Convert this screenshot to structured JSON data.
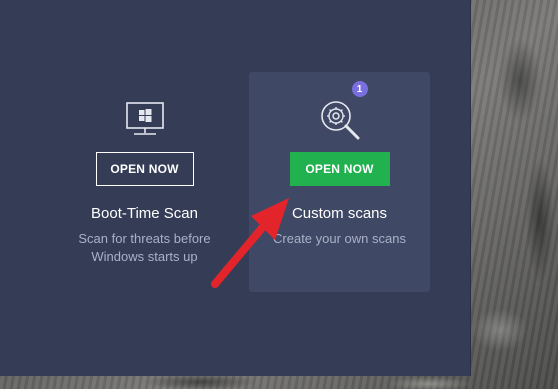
{
  "cards": [
    {
      "title": "Boot-Time Scan",
      "button": "OPEN NOW",
      "description_line1": "Scan for threats before",
      "description_line2": "Windows starts up",
      "icon": "monitor-windows-icon"
    },
    {
      "title": "Custom scans",
      "button": "OPEN NOW",
      "description_line1": "Create your own scans",
      "badge": "1",
      "icon": "search-gear-icon"
    }
  ],
  "colors": {
    "panel": "#343c56",
    "card_highlight": "#3f4864",
    "button_green": "#21b14f",
    "badge": "#7a6fe0",
    "arrow": "#e3252b"
  },
  "annotation": {
    "icon": "red-arrow-icon"
  }
}
